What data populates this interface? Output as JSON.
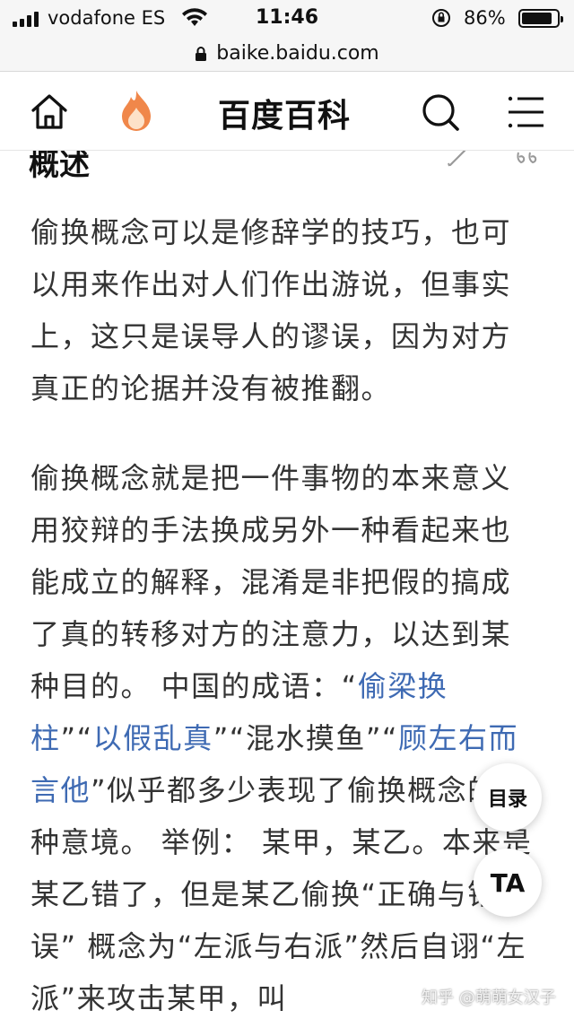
{
  "status_bar": {
    "carrier": "vodafone ES",
    "time": "11:46",
    "battery_percent": "86%",
    "battery_level": 0.86
  },
  "browser": {
    "url": "baike.baidu.com"
  },
  "nav": {
    "title": "百度百科",
    "home_icon": "home-icon",
    "hot_icon": "flame-icon",
    "search_icon": "search-icon",
    "menu_icon": "menu-icon"
  },
  "article": {
    "section_heading": "概述",
    "paragraph1": "偷换概念可以是修辞学的技巧，也可以用来作出对人们作出游说，但事实上，这只是误导人的谬误，因为对方真正的论据并没有被推翻。",
    "paragraph2": {
      "text_a": "偷换概念就是把一件事物的本来意义用狡辩的手法换成另外一种看起来也能成立的解释，混淆是非把假的搞成了真的转移对方的注意力，以达到某种目的。 中国的成语：“",
      "link1": "偷梁换柱",
      "text_b": "”“",
      "link2": "以假乱真",
      "text_c": "”“混水摸鱼”“",
      "link3": "顾左右而言他",
      "text_d": "”似乎都多少表现了偷换概念的那种意境。 举例： 某甲，某乙。本来是某乙错了，但是某乙偷换“正确与错误” 概念为“左派与右派”然后自诩“左派”来攻击某甲，叫"
    }
  },
  "floating": {
    "toc_label": "目录",
    "ta_label": "TA"
  },
  "watermark": "知乎 @萌萌女汉子"
}
